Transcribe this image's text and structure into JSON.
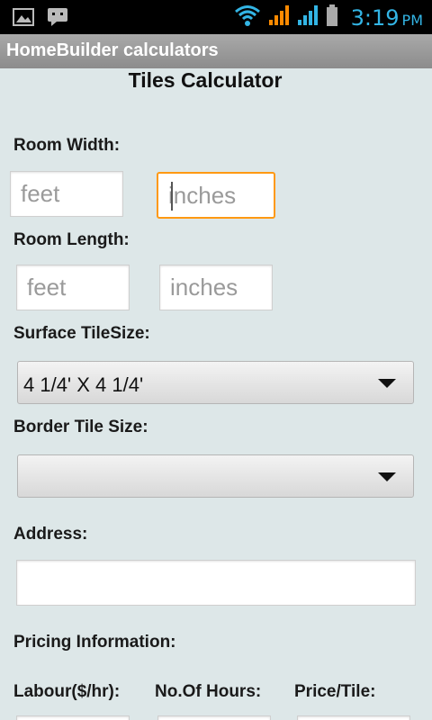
{
  "status_bar": {
    "icons_left": [
      "image-notification-icon",
      "chat-notification-icon"
    ],
    "icons_right": [
      "wifi-icon",
      "signal-icon",
      "signal-icon",
      "battery-icon"
    ],
    "time": "3:19",
    "ampm": "PM",
    "accent_color": "#33b5e5"
  },
  "app_bar": {
    "title": "HomeBuilder calculators"
  },
  "page": {
    "heading": "Tiles Calculator"
  },
  "form": {
    "room_width": {
      "label": "Room Width:",
      "feet_placeholder": "feet",
      "inches_placeholder": "inches"
    },
    "room_length": {
      "label": "Room Length:",
      "feet_placeholder": "feet",
      "inches_placeholder": "inches"
    },
    "surface_tile": {
      "label": "Surface TileSize:",
      "selected": "4 1/4' X 4 1/4'"
    },
    "border_tile": {
      "label": "Border Tile Size:",
      "selected": ""
    },
    "address": {
      "label": "Address:",
      "value": ""
    },
    "pricing": {
      "label": "Pricing Information:"
    },
    "labour": {
      "label": "Labour($/hr):"
    },
    "hours": {
      "label": "No.Of Hours:"
    },
    "price_tile": {
      "label": "Price/Tile:"
    }
  },
  "colors": {
    "focus_border": "#ff9912",
    "background": "#dde7e8"
  }
}
